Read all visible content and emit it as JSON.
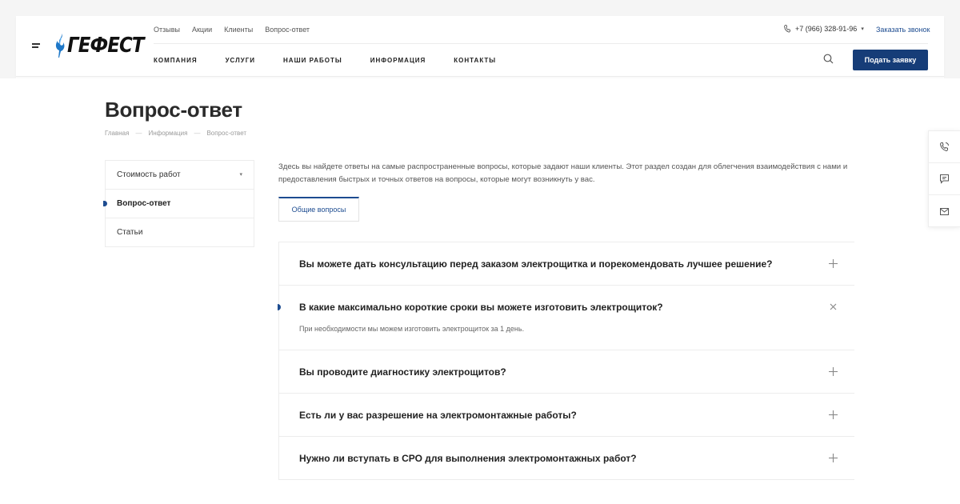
{
  "header": {
    "logo_text": "ГЕФЕСТ",
    "top_nav": [
      "Отзывы",
      "Акции",
      "Клиенты",
      "Вопрос-ответ"
    ],
    "main_nav": [
      "КОМПАНИЯ",
      "УСЛУГИ",
      "НАШИ РАБОТЫ",
      "ИНФОРМАЦИЯ",
      "КОНТАКТЫ"
    ],
    "phone": "+7 (966) 328-91-96",
    "callback_label": "Заказать звонок",
    "cta_label": "Подать заявку"
  },
  "page": {
    "title": "Вопрос-ответ",
    "breadcrumb": [
      "Главная",
      "Информация",
      "Вопрос-ответ"
    ],
    "breadcrumb_sep": "—"
  },
  "sidebar": {
    "items": [
      {
        "label": "Стоимость работ",
        "has_children": true
      },
      {
        "label": "Вопрос-ответ",
        "active": true
      },
      {
        "label": "Статьи"
      }
    ]
  },
  "main": {
    "intro": "Здесь вы найдете ответы на самые распространенные вопросы, которые задают наши клиенты. Этот раздел создан для облегчения взаимодействия с нами и предоставления быстрых и точных ответов на вопросы, которые могут возникнуть у вас.",
    "tab_label": "Общие вопросы",
    "faq": [
      {
        "question": "Вы можете дать консультацию перед заказом электрощитка и порекомендовать лучшее решение?",
        "open": false
      },
      {
        "question": "В какие максимально короткие сроки вы можете изготовить электрощиток?",
        "open": true,
        "answer": "При необходимости мы можем изготовить электрощиток за 1 день."
      },
      {
        "question": "Вы проводите диагностику электрощитов?",
        "open": false
      },
      {
        "question": "Есть ли у вас разрешение на электромонтажные работы?",
        "open": false
      },
      {
        "question": "Нужно ли вступать в СРО для выполнения электромонтажных работ?",
        "open": false
      }
    ]
  },
  "colors": {
    "accent": "#163d78",
    "link": "#1d4c90"
  },
  "icons": {
    "float_panel": [
      "phone-call-icon",
      "chat-icon",
      "mail-icon"
    ]
  }
}
